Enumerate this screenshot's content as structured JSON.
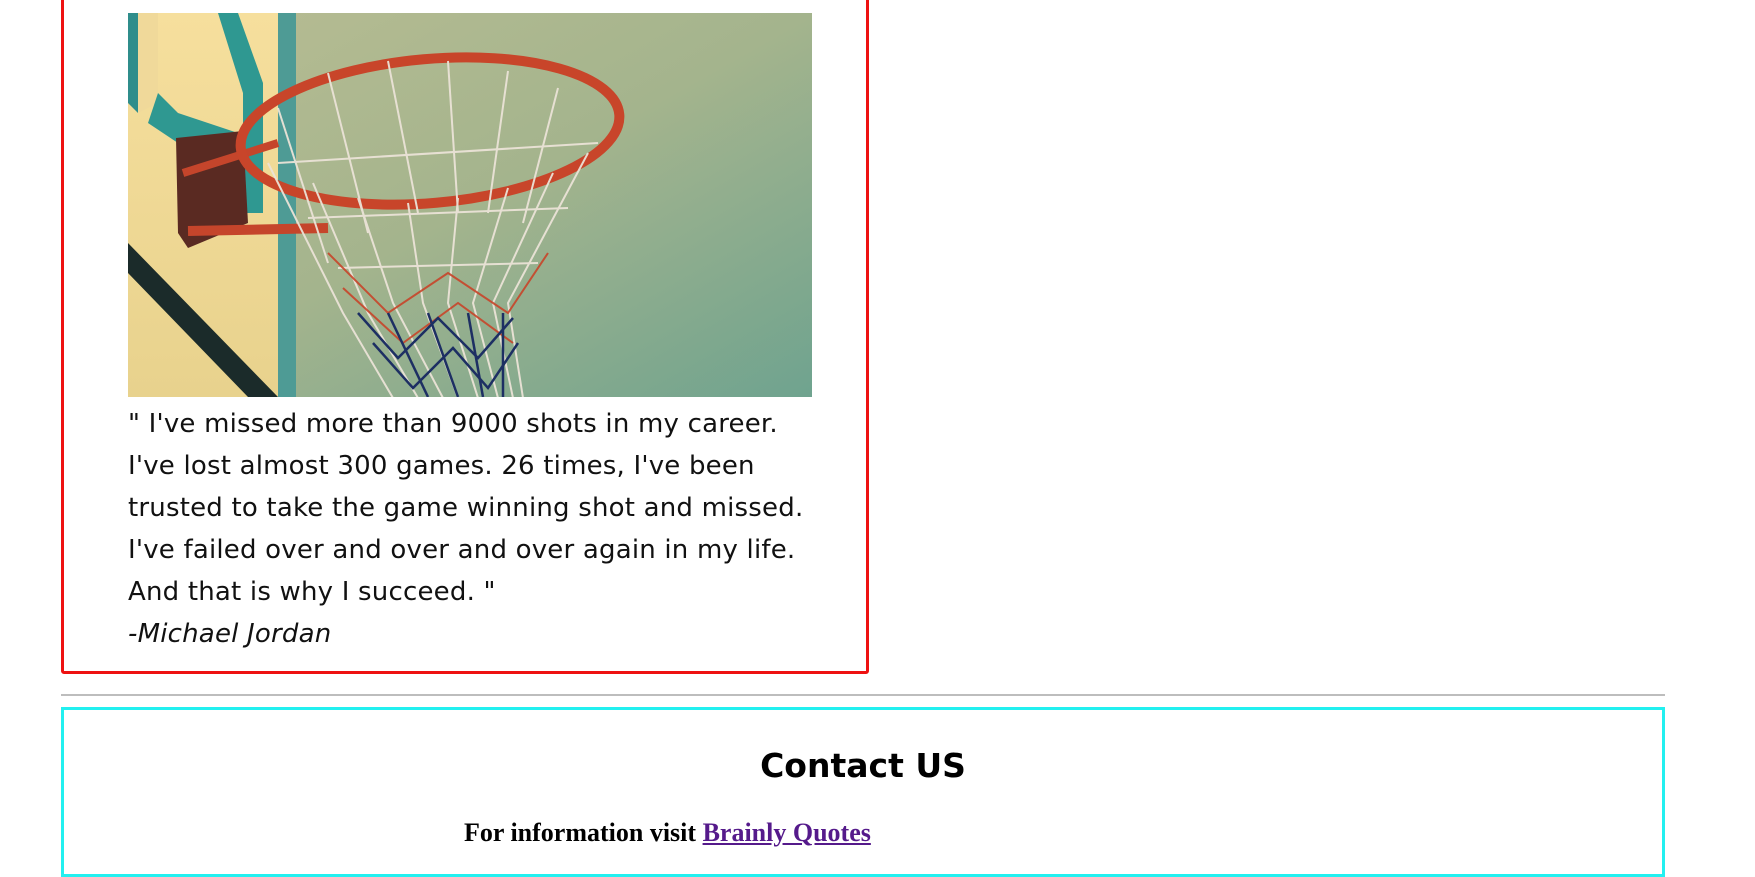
{
  "quote": {
    "text": "\" I've missed more than 9000 shots in my career. I've lost almost 300 games. 26 times, I've been trusted to take the game winning shot and missed. I've failed over and over and over again in my life. And that is why I succeed. \"",
    "author": "-Michael Jordan"
  },
  "contact": {
    "title": "Contact US",
    "info_prefix": "For information visit ",
    "link_label": "Brainly Quotes"
  },
  "colors": {
    "card_border": "#ee1111",
    "contact_border": "#22f0f0",
    "divider": "#bdbdbd",
    "link_visited": "#551a8b"
  },
  "icons": {
    "hero_image": "basketball-hoop-image"
  }
}
